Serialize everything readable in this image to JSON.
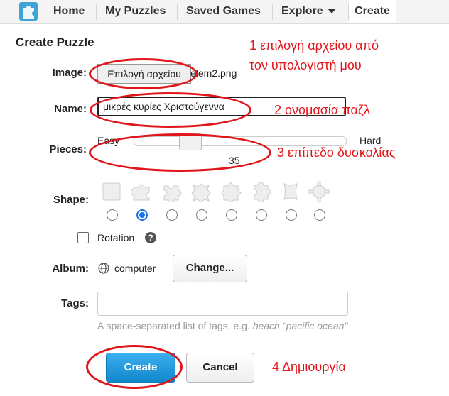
{
  "nav": {
    "items": [
      "Home",
      "My Puzzles",
      "Saved Games",
      "Explore",
      "Create"
    ]
  },
  "form": {
    "title": "Create Puzzle",
    "image_label": "Image:",
    "file_button": "Επιλογή αρχείου",
    "file_name": "elem2.png",
    "name_label": "Name:",
    "name_value": "μικρές κυρίες Χριστούγεννα",
    "pieces_label": "Pieces:",
    "easy": "Easy",
    "hard": "Hard",
    "pieces_value": "35",
    "pieces_fraction": 0.24,
    "shape_label": "Shape:",
    "shape_selected_index": 1,
    "rotation_label": "Rotation",
    "album_label": "Album:",
    "album_value": "computer",
    "change_button": "Change...",
    "tags_label": "Tags:",
    "tags_value": "",
    "hint_prefix": "A space-separated list of tags, e.g. ",
    "hint_example": "beach \"pacific ocean\"",
    "create_button": "Create",
    "cancel_button": "Cancel"
  },
  "annotations": {
    "step1_line1": "1 επιλογή αρχείου από",
    "step1_line2": "τον υπολογιστή μου",
    "step2": "2 ονομασία παζλ",
    "step3": "3 επίπεδο δυσκολίας",
    "step4": "4 Δημιουργία"
  },
  "colors": {
    "accent": "#1288cc",
    "annotation": "#e0161b",
    "radio_selected": "#1a73e8"
  }
}
